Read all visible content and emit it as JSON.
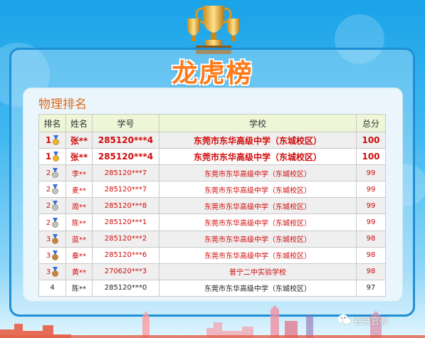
{
  "title": "龙虎榜",
  "panel_title": "物理排名",
  "table": {
    "headers": [
      "排名",
      "姓名",
      "学号",
      "学校",
      "总分"
    ],
    "rows": [
      {
        "rank": "1",
        "medal": "gold",
        "name": "张**",
        "id": "285120***4",
        "school": "东莞市东华高级中学（东城校区）",
        "score": "100"
      },
      {
        "rank": "1",
        "medal": "gold",
        "name": "张**",
        "id": "285120***4",
        "school": "东莞市东华高级中学（东城校区）",
        "score": "100"
      },
      {
        "rank": "2",
        "medal": "silver",
        "name": "李**",
        "id": "285120***7",
        "school": "东莞市东华高级中学（东城校区）",
        "score": "99"
      },
      {
        "rank": "2",
        "medal": "silver",
        "name": "麦**",
        "id": "285120***7",
        "school": "东莞市东华高级中学（东城校区）",
        "score": "99"
      },
      {
        "rank": "2",
        "medal": "silver",
        "name": "周**",
        "id": "285120***8",
        "school": "东莞市东华高级中学（东城校区）",
        "score": "99"
      },
      {
        "rank": "2",
        "medal": "silver",
        "name": "陈**",
        "id": "285120***1",
        "school": "东莞市东华高级中学（东城校区）",
        "score": "99"
      },
      {
        "rank": "3",
        "medal": "bronze",
        "name": "蓝**",
        "id": "285120***2",
        "school": "东莞市东华高级中学（东城校区）",
        "score": "98"
      },
      {
        "rank": "3",
        "medal": "bronze",
        "name": "秦**",
        "id": "285120***6",
        "school": "东莞市东华高级中学（东城校区）",
        "score": "98"
      },
      {
        "rank": "3",
        "medal": "bronze",
        "name": "黄**",
        "id": "270620***3",
        "school": "普宁二中实验学校",
        "score": "98"
      },
      {
        "rank": "4",
        "medal": "",
        "name": "陈**",
        "id": "285120***0",
        "school": "东莞市东华高级中学（东城校区）",
        "score": "97"
      }
    ]
  },
  "watermark": "睿芽官微",
  "colors": {
    "title": "#ff7a1a",
    "panel_title": "#e06a18",
    "highlight_text": "#d10b0b",
    "header_bg": "#eef6d8",
    "gold": "#f3b51c",
    "silver": "#b8c3cc",
    "bronze": "#c9803d"
  },
  "icons": {
    "trophy": "trophy-icon",
    "medal": "medal-icon",
    "watermark": "wechat-icon"
  }
}
